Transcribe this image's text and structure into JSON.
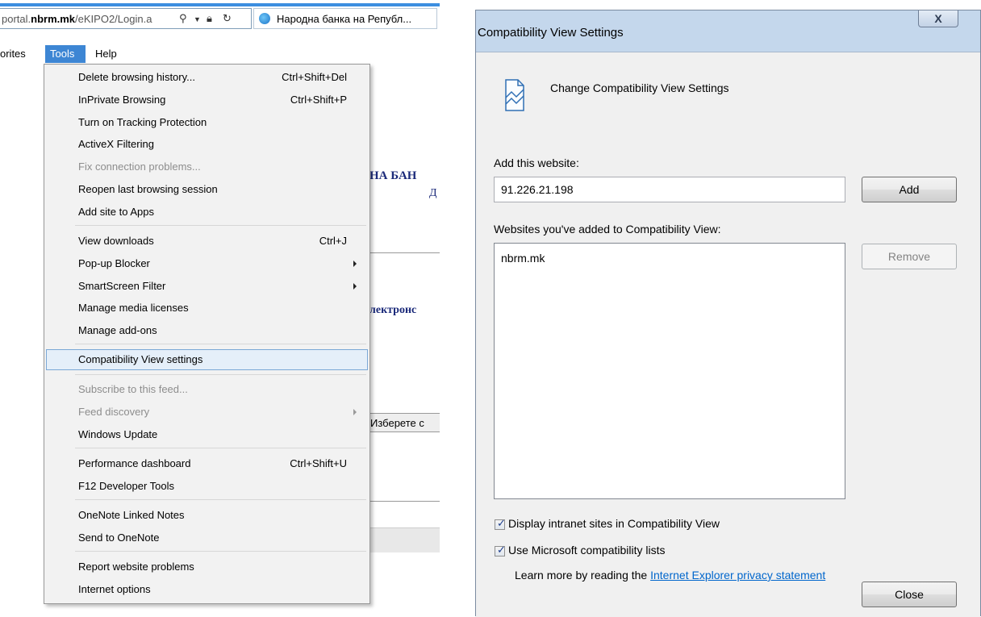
{
  "browser": {
    "address": {
      "prefix": "portal.",
      "domain": "nbrm.mk",
      "path": "/eKIPO2/Login.a"
    },
    "tab_title": "Народна банка на Републ...",
    "menubar": {
      "favorites": "orites",
      "tools": "Tools",
      "help": "Help"
    },
    "page_fragments": {
      "heading": "НА БАН",
      "link": "Д",
      "subheading": "лектронс",
      "select": "Изберете с"
    }
  },
  "tools_menu": {
    "items": [
      {
        "label": "Delete browsing history...",
        "shortcut": "Ctrl+Shift+Del"
      },
      {
        "label": "InPrivate Browsing",
        "shortcut": "Ctrl+Shift+P"
      },
      {
        "label": "Turn on Tracking Protection"
      },
      {
        "label": "ActiveX Filtering"
      },
      {
        "label": "Fix connection problems..."
      },
      {
        "label": "Reopen last browsing session"
      },
      {
        "label": "Add site to Apps"
      },
      {
        "label": "View downloads",
        "shortcut": "Ctrl+J"
      },
      {
        "label": "Pop-up Blocker"
      },
      {
        "label": "SmartScreen Filter"
      },
      {
        "label": "Manage media licenses"
      },
      {
        "label": "Manage add-ons"
      },
      {
        "label": "Compatibility View settings"
      },
      {
        "label": "Subscribe to this feed..."
      },
      {
        "label": "Feed discovery"
      },
      {
        "label": "Windows Update"
      },
      {
        "label": "Performance dashboard",
        "shortcut": "Ctrl+Shift+U"
      },
      {
        "label": "F12 Developer Tools"
      },
      {
        "label": "OneNote Linked Notes"
      },
      {
        "label": "Send to OneNote"
      },
      {
        "label": "Report website problems"
      },
      {
        "label": "Internet options"
      }
    ]
  },
  "dialog": {
    "title": "Compatibility View Settings",
    "close_glyph": "X",
    "heading": "Change Compatibility View Settings",
    "add_label": "Add this website:",
    "add_value": "91.226.21.198",
    "add_button": "Add",
    "list_label": "Websites you've added to Compatibility View:",
    "sites": [
      "nbrm.mk"
    ],
    "remove_button": "Remove",
    "checkbox_intranet": {
      "label": "Display intranet sites in Compatibility View",
      "checked": true
    },
    "checkbox_mslists": {
      "label": "Use Microsoft compatibility lists",
      "checked": true
    },
    "learn_more_prefix": "Learn more by reading the",
    "privacy_link": "Internet Explorer privacy statement",
    "close_button": "Close"
  }
}
